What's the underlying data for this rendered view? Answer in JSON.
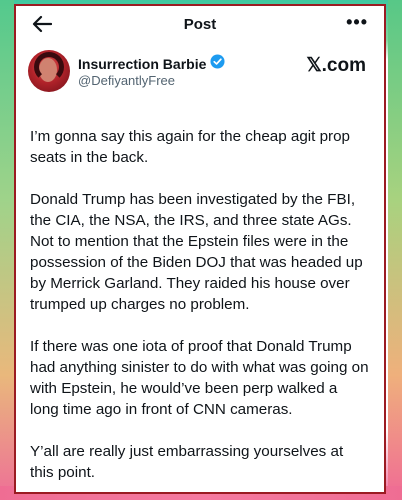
{
  "header": {
    "title": "Post",
    "back_icon": "arrow-left-icon",
    "more_icon": "more-horizontal-icon"
  },
  "author": {
    "name": "Insurrection Barbie",
    "handle": "@DefiyantlyFree",
    "verified_icon": "verified-badge-icon",
    "badge_color": "#1d9bf0"
  },
  "watermark": "𝕏.com",
  "post": {
    "paragraphs": [
      "I’m gonna say this again for the cheap agit prop seats in the back.",
      "Donald Trump has been investigated by the FBI, the CIA, the NSA, the IRS, and three state AGs. Not to mention that the Epstein files were in the possession of the Biden DOJ that was headed up by Merrick Garland. They raided his house over trumped up charges no problem.",
      "If there was one iota of proof that Donald Trump had anything sinister to do with what was going on with Epstein, he would’ve been perp walked a long time ago in front of CNN cameras.",
      "Y’all are really just embarrassing yourselves at this point."
    ]
  },
  "colors": {
    "frame_border": "#9b1b22",
    "text": "#0f1419",
    "muted": "#536471"
  }
}
